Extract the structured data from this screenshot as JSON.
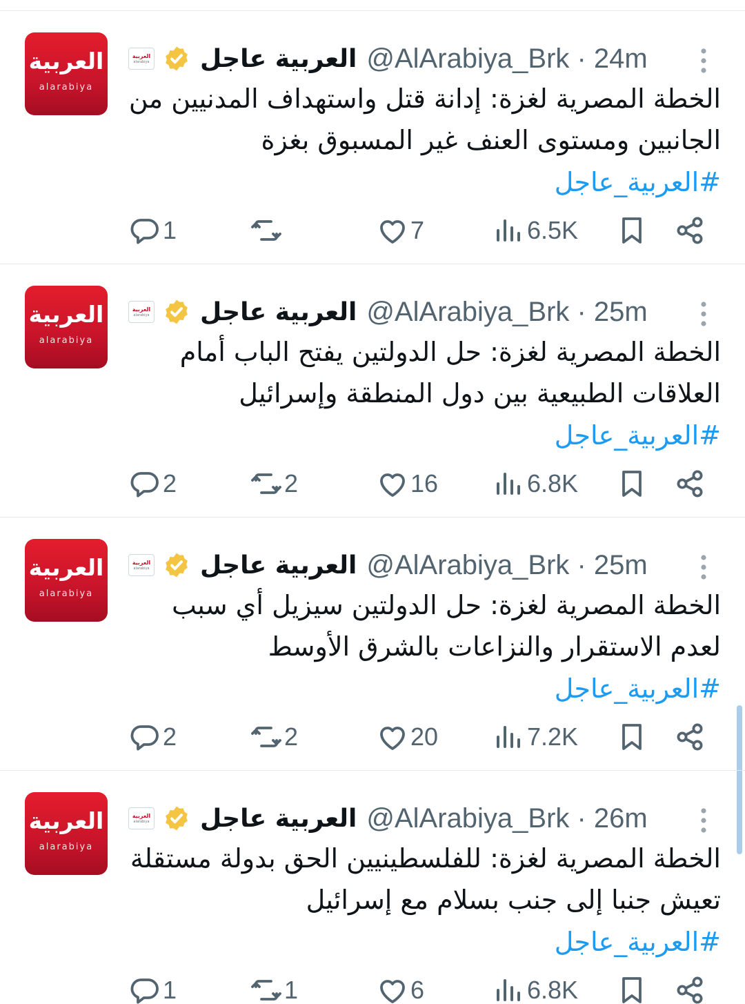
{
  "accent_color": "#1d9bf0",
  "verified_color": "#f4c542",
  "tweets": [
    {
      "display_name": "العربية عاجل",
      "handle_time": "@AlArabiya_Brk · 24m",
      "lines": [
        "الخطة المصرية لغزة: إدانة قتل واستهداف المدنيين من",
        "الجانبين ومستوى العنف غير المسبوق بغزة"
      ],
      "hashtag": "#العربية_عاجل",
      "replies": "1",
      "retweets": "",
      "likes": "7",
      "views": "6.5K"
    },
    {
      "display_name": "العربية عاجل",
      "handle_time": "@AlArabiya_Brk · 25m",
      "lines": [
        "الخطة المصرية لغزة: حل الدولتين يفتح الباب أمام",
        "العلاقات الطبيعية بين دول المنطقة وإسرائيل"
      ],
      "hashtag": "#العربية_عاجل",
      "replies": "2",
      "retweets": "2",
      "likes": "16",
      "views": "6.8K"
    },
    {
      "display_name": "العربية عاجل",
      "handle_time": "@AlArabiya_Brk · 25m",
      "lines": [
        "الخطة المصرية لغزة: حل الدولتين سيزيل أي سبب",
        "لعدم الاستقرار والنزاعات بالشرق الأوسط"
      ],
      "hashtag": "#العربية_عاجل",
      "replies": "2",
      "retweets": "2",
      "likes": "20",
      "views": "7.2K"
    },
    {
      "display_name": "العربية عاجل",
      "handle_time": "@AlArabiya_Brk · 26m",
      "lines": [
        "الخطة المصرية لغزة: للفلسطينيين الحق بدولة مستقلة",
        "تعيش جنبا إلى جنب بسلام مع إسرائيل"
      ],
      "hashtag": "#العربية_عاجل",
      "replies": "1",
      "retweets": "1",
      "likes": "6",
      "views": "6.8K"
    }
  ],
  "avatar": {
    "logo_ar": "العربية",
    "logo_en": "alarabiya",
    "badge_ar": "العربية",
    "badge_en": "alarabiya"
  },
  "icons": {
    "reply": "reply-icon",
    "retweet": "retweet-icon",
    "like": "heart-icon",
    "views": "views-icon",
    "bookmark": "bookmark-icon",
    "share": "share-icon",
    "more": "more-vertical-icon",
    "verified": "verified-badge-icon"
  }
}
